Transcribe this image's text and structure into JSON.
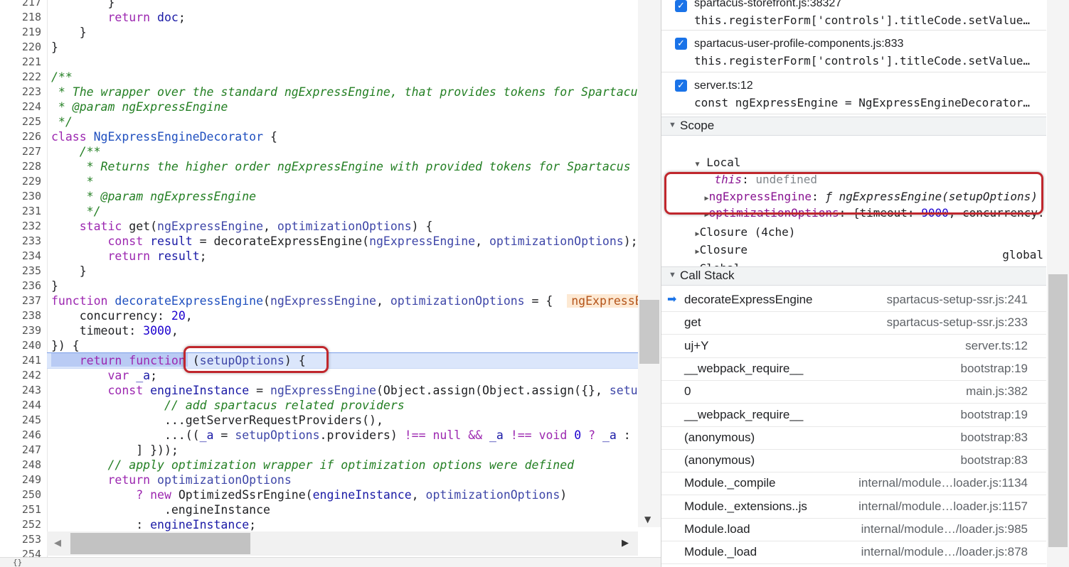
{
  "editor": {
    "lines": [
      {
        "n": "217",
        "html": "        }"
      },
      {
        "n": "218",
        "html": "        <span class='kw'>return</span> <span class='var'>doc</span>;"
      },
      {
        "n": "219",
        "html": "    }"
      },
      {
        "n": "220",
        "html": "}"
      },
      {
        "n": "221",
        "html": ""
      },
      {
        "n": "222",
        "html": "<span class='cm'>/**</span>"
      },
      {
        "n": "223",
        "html": "<span class='cm'> * The wrapper over the standard ngExpressEngine, that provides tokens for Spartacus</span>"
      },
      {
        "n": "224",
        "html": "<span class='cm'> * @param ngExpressEngine</span>"
      },
      {
        "n": "225",
        "html": "<span class='cm'> */</span>"
      },
      {
        "n": "226",
        "html": "<span class='kw'>class</span> <span class='cls'>NgExpressEngineDecorator</span> {"
      },
      {
        "n": "227",
        "html": "    <span class='cm'>/**</span>"
      },
      {
        "n": "228",
        "html": "<span class='cm'>     * Returns the higher order ngExpressEngine with provided tokens for Spartacus</span>"
      },
      {
        "n": "229",
        "html": "<span class='cm'>     *</span>"
      },
      {
        "n": "230",
        "html": "<span class='cm'>     * @param ngExpressEngine</span>"
      },
      {
        "n": "231",
        "html": "<span class='cm'>     */</span>"
      },
      {
        "n": "232",
        "html": "    <span class='kw'>static</span> get(<span class='pm'>ngExpressEngine</span>, <span class='pm'>optimizationOptions</span>) {"
      },
      {
        "n": "233",
        "html": "        <span class='kw'>const</span> <span class='var'>result</span> = decorateExpressEngine(<span class='pm'>ngExpressEngine</span>, <span class='pm'>optimizationOptions</span>);"
      },
      {
        "n": "234",
        "html": "        <span class='kw'>return</span> <span class='var'>result</span>;"
      },
      {
        "n": "235",
        "html": "    }"
      },
      {
        "n": "236",
        "html": "}"
      },
      {
        "n": "237",
        "html": "<span class='kw'>function</span> <span class='cls'>decorateExpressEngine</span>(<span class='pm'>ngExpressEngine</span>, <span class='pm'>optimizationOptions</span> = {  <span class='inline-val'>ngExpressEngine = ƒ</span>"
      },
      {
        "n": "238",
        "html": "    concurrency: <span class='num'>20</span>,"
      },
      {
        "n": "239",
        "html": "    timeout: <span class='num'>3000</span>,"
      },
      {
        "n": "240",
        "html": "}) {"
      },
      {
        "n": "241",
        "html": "    <span class='kw'>return</span> <span class='kw'>function</span> (<span class='pm'>setupOptions</span>) {"
      },
      {
        "n": "242",
        "html": "        <span class='kw'>var</span> <span class='var'>_a</span>;"
      },
      {
        "n": "243",
        "html": "        <span class='kw'>const</span> <span class='var'>engineInstance</span> = <span class='pm'>ngExpressEngine</span>(Object.assign(Object.assign({}, <span class='pm'>setupOptions</span>"
      },
      {
        "n": "244",
        "html": "<span class='cm'>                // add spartacus related providers</span>"
      },
      {
        "n": "245",
        "html": "                ...getServerRequestProviders(),"
      },
      {
        "n": "246",
        "html": "                ...((<span class='var'>_a</span> = <span class='pm'>setupOptions</span>.providers) <span class='kw'>!==</span> <span class='kw'>null</span> <span class='kw'>&amp;&amp;</span> <span class='var'>_a</span> <span class='kw'>!==</span> <span class='kw'>void</span> <span class='num'>0</span> <span class='kw'>?</span> <span class='var'>_a</span> : ["
      },
      {
        "n": "247",
        "html": "            ] }));"
      },
      {
        "n": "248",
        "html": "<span class='cm'>        // apply optimization wrapper if optimization options were defined</span>"
      },
      {
        "n": "249",
        "html": "        <span class='kw'>return</span> <span class='pm'>optimizationOptions</span>"
      },
      {
        "n": "250",
        "html": "            <span class='kw'>?</span> <span class='kw'>new</span> OptimizedSsrEngine(<span class='var'>engineInstance</span>, <span class='pm'>optimizationOptions</span>)"
      },
      {
        "n": "251",
        "html": "                .engineInstance"
      },
      {
        "n": "252",
        "html": "            : <span class='var'>engineInstance</span>;"
      },
      {
        "n": "253",
        "html": ""
      },
      {
        "n": "254",
        "html": ""
      }
    ],
    "status_text": "{}"
  },
  "breakpoints": [
    {
      "location": "spartacus-storefront.js:38327",
      "code": "this.registerForm['controls'].titleCode.setValue…"
    },
    {
      "location": "spartacus-user-profile-components.js:833",
      "code": "this.registerForm['controls'].titleCode.setValue…"
    },
    {
      "location": "server.ts:12",
      "code": "const ngExpressEngine = NgExpressEngineDecorator…"
    }
  ],
  "scope": {
    "title": "Scope",
    "local_label": "Local",
    "this_key": "this",
    "this_val": "undefined",
    "ng_key": "ngExpressEngine",
    "ng_val": "ƒ ngExpressEngine(setupOptions)",
    "opt_key": "optimizationOptions",
    "opt_pre": "{timeout: ",
    "opt_num": "9000",
    "opt_post": ", concurrency: …",
    "closure1": "Closure (4che)",
    "closure2": "Closure",
    "global": "Global",
    "global_val": "global"
  },
  "callstack": {
    "title": "Call Stack",
    "frames": [
      {
        "name": "decorateExpressEngine",
        "loc": "spartacus-setup-ssr.js:241",
        "current": true
      },
      {
        "name": "get",
        "loc": "spartacus-setup-ssr.js:233"
      },
      {
        "name": "uj+Y",
        "loc": "server.ts:12"
      },
      {
        "name": "__webpack_require__",
        "loc": "bootstrap:19"
      },
      {
        "name": "0",
        "loc": "main.js:382"
      },
      {
        "name": "__webpack_require__",
        "loc": "bootstrap:19"
      },
      {
        "name": "(anonymous)",
        "loc": "bootstrap:83"
      },
      {
        "name": "(anonymous)",
        "loc": "bootstrap:83"
      },
      {
        "name": "Module._compile",
        "loc": "internal/module…loader.js:1134"
      },
      {
        "name": "Module._extensions..js",
        "loc": "internal/module…loader.js:1157"
      },
      {
        "name": "Module.load",
        "loc": "internal/module…/loader.js:985"
      },
      {
        "name": "Module._load",
        "loc": "internal/module…/loader.js:878"
      }
    ]
  },
  "icons": {
    "checkbox": "checkmark-icon",
    "expand": "triangle-down-icon",
    "collapse": "triangle-right-icon",
    "current_frame": "arrow-right-icon"
  }
}
